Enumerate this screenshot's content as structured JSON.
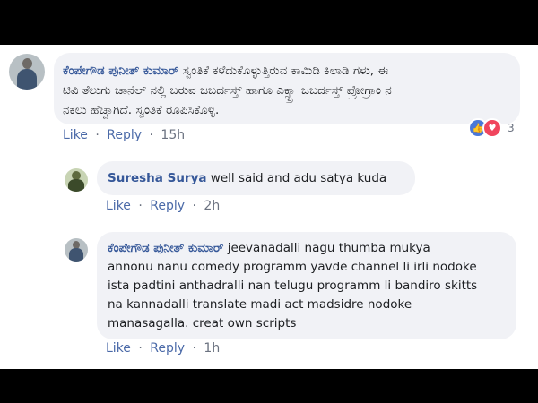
{
  "comments": [
    {
      "author": "ಕೆಂಪೇಗೌಡ ಪುನೀತ್ ಕುಮಾರ್",
      "text_line1": " ಸ್ವಂತಿಕೆ ಕಳೆದುಕೊಳ್ಳುತ್ತಿರುವ ಕಾಮಿಡಿ ಕಿಲಾಡಿ ಗಳು, ಈ",
      "text_line2": "ಟಿವಿ ತೆಲುಗು ಚಾನೆಲ್ ನಲ್ಲಿ ಬರುವ ಜಬರ್ದಸ್ತ್ ಹಾಗೂ ಎಕ್ಸ್ಟ್ರಾ ಜಬರ್ದಸ್ತ್ ಪ್ರೋಗ್ರಾಂ ನ",
      "text_line3": "ನಕಲು ಹೆಚ್ಚಾಗಿದೆ. ಸ್ವಂತಿಕೆ ರೂಪಿಸಿಕೊಳ್ಳಿ.",
      "like_label": "Like",
      "reply_label": "Reply",
      "time": "15h",
      "reaction_count": "3"
    },
    {
      "author": "Suresha Surya",
      "text": " well said and adu satya kuda",
      "like_label": "Like",
      "reply_label": "Reply",
      "time": "2h"
    },
    {
      "author": "ಕೆಂಪೇಗೌಡ ಪುನೀತ್ ಕುಮಾರ್",
      "text_line1": " jeevanadalli nagu thumba mukya",
      "text_line2": "annonu nanu comedy programm yavde channel li irli nodoke",
      "text_line3": "ista padtini anthadralli nan telugu programm li bandiro skitts",
      "text_line4": "na kannadalli translate madi act madsidre nodoke",
      "text_line5": "manasagalla. creat own scripts",
      "like_label": "Like",
      "reply_label": "Reply",
      "time": "1h"
    }
  ],
  "separator": "·",
  "colors": {
    "link": "#365899",
    "bubble": "#f1f2f6",
    "action": "#4b6aa8"
  },
  "icons": [
    "like-reaction-icon",
    "love-reaction-icon"
  ]
}
